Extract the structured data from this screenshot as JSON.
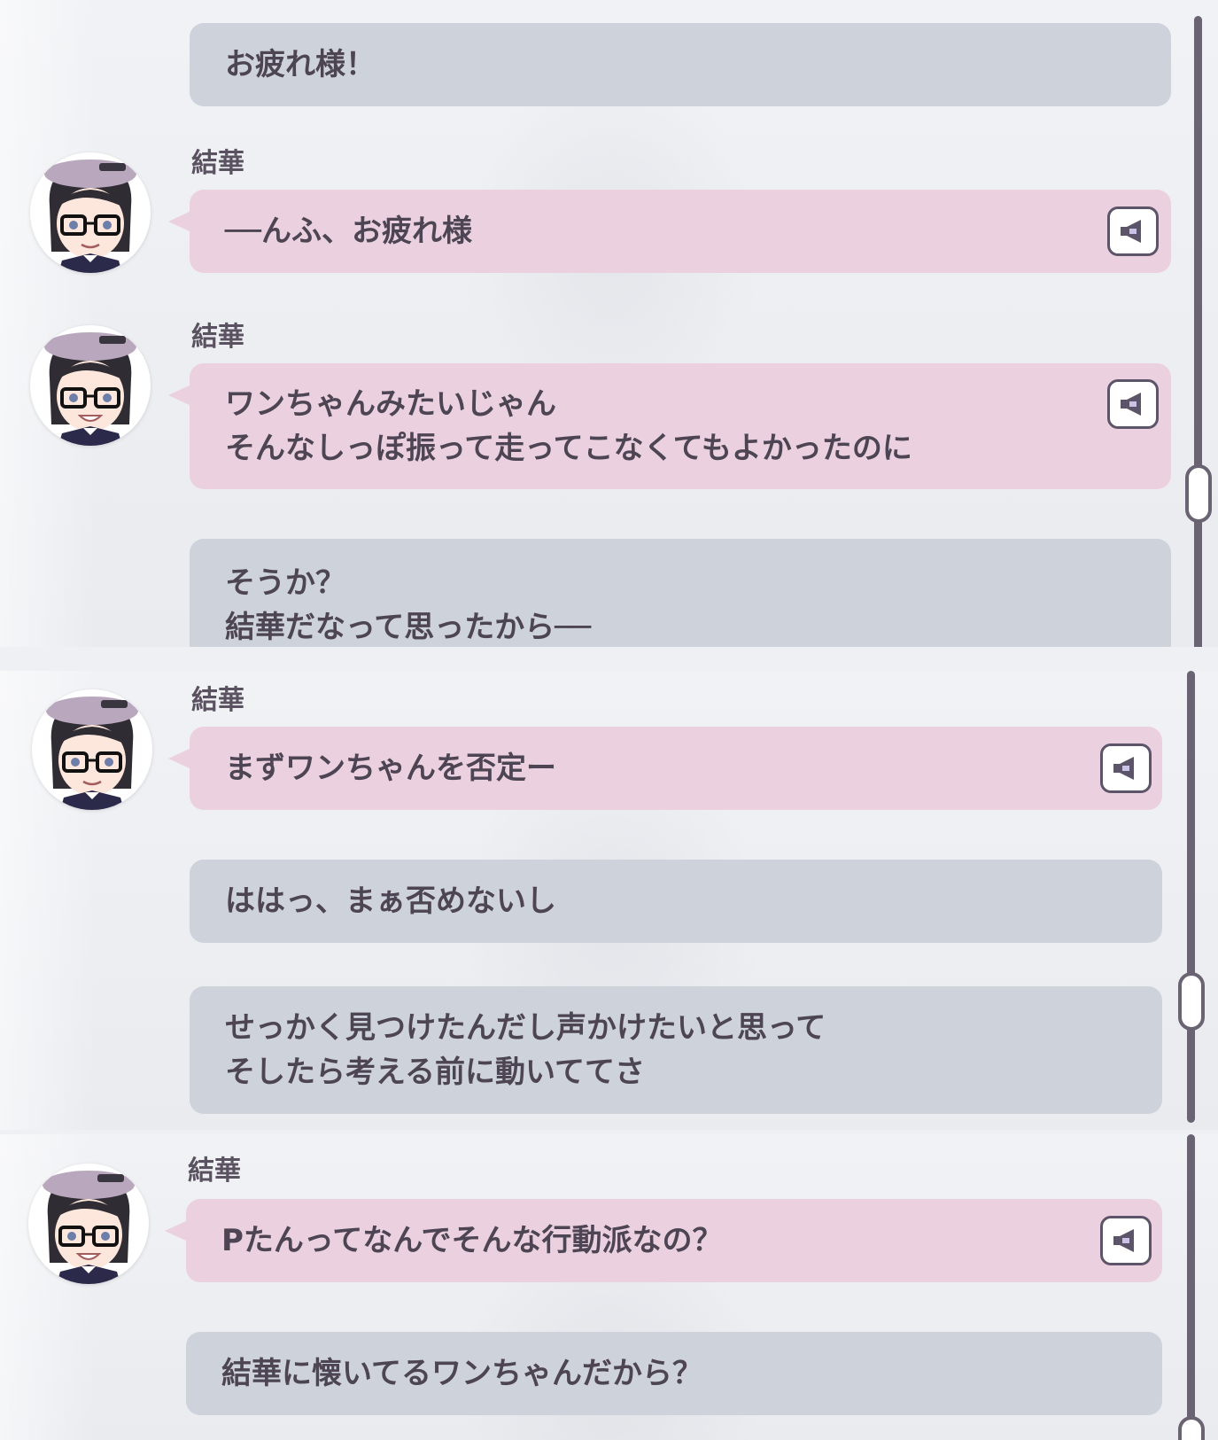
{
  "speaker_name": "結華",
  "messages": {
    "m1": {
      "lines": [
        "お疲れ様！"
      ]
    },
    "m2": {
      "lines": [
        "──んふ、お疲れ様"
      ]
    },
    "m3": {
      "lines": [
        "ワンちゃんみたいじゃん",
        "そんなしっぽ振って走ってこなくてもよかったのに"
      ]
    },
    "m4": {
      "lines": [
        "そうか？",
        "結華だなって思ったから──"
      ]
    },
    "m5": {
      "lines": [
        "まずワンちゃんを否定ー"
      ]
    },
    "m6": {
      "lines": [
        "ははっ、まぁ否めないし"
      ]
    },
    "m7": {
      "lines": [
        "せっかく見つけたんだし声かけたいと思って",
        "そしたら考える前に動いててさ"
      ]
    },
    "m8": {
      "lines": [
        "Pたんってなんでそんな行動派なの？"
      ]
    },
    "m9": {
      "lines": [
        "結華に懐いてるワンちゃんだから？"
      ]
    }
  },
  "icons": {
    "voice": "speaker-icon",
    "avatar": "character-avatar-icon"
  },
  "colors": {
    "player_bubble": "#ced2da",
    "character_bubble": "#ebd1df",
    "text": "#4d4553",
    "scrollbar": "#6a6372"
  }
}
